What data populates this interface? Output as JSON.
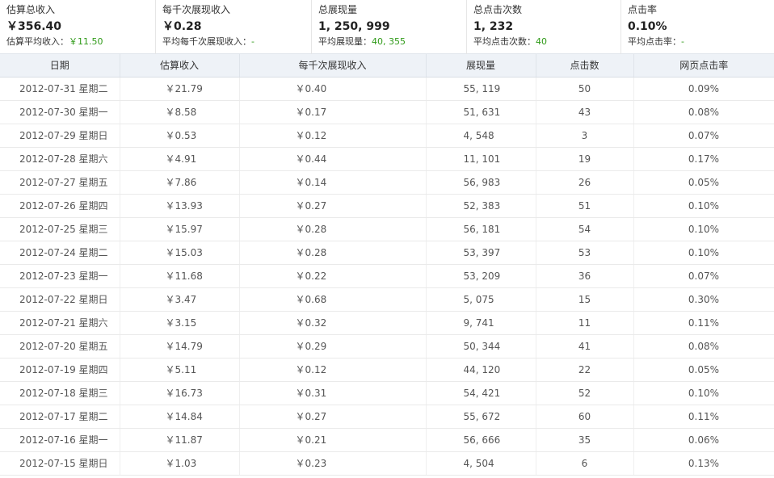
{
  "summary": [
    {
      "label": "估算总收入",
      "value": "￥356.40",
      "sub_label": "估算平均收入：",
      "sub_value": "￥11.50"
    },
    {
      "label": "每千次展现收入",
      "value": "￥0.28",
      "sub_label": "平均每千次展现收入：",
      "sub_value": "-"
    },
    {
      "label": "总展现量",
      "value": "1, 250, 999",
      "sub_label": "平均展现量：",
      "sub_value": "40, 355"
    },
    {
      "label": "总点击次数",
      "value": "1, 232",
      "sub_label": "平均点击次数：",
      "sub_value": "40"
    },
    {
      "label": "点击率",
      "value": "0.10%",
      "sub_label": "平均点击率：",
      "sub_value": "-"
    }
  ],
  "table": {
    "headers": [
      "日期",
      "估算收入",
      "每千次展现收入",
      "展现量",
      "点击数",
      "网页点击率"
    ],
    "rows": [
      [
        "2012-07-31 星期二",
        "￥21.79",
        "￥0.40",
        "55, 119",
        "50",
        "0.09%"
      ],
      [
        "2012-07-30 星期一",
        "￥8.58",
        "￥0.17",
        "51, 631",
        "43",
        "0.08%"
      ],
      [
        "2012-07-29 星期日",
        "￥0.53",
        "￥0.12",
        "4, 548",
        "3",
        "0.07%"
      ],
      [
        "2012-07-28 星期六",
        "￥4.91",
        "￥0.44",
        "11, 101",
        "19",
        "0.17%"
      ],
      [
        "2012-07-27 星期五",
        "￥7.86",
        "￥0.14",
        "56, 983",
        "26",
        "0.05%"
      ],
      [
        "2012-07-26 星期四",
        "￥13.93",
        "￥0.27",
        "52, 383",
        "51",
        "0.10%"
      ],
      [
        "2012-07-25 星期三",
        "￥15.97",
        "￥0.28",
        "56, 181",
        "54",
        "0.10%"
      ],
      [
        "2012-07-24 星期二",
        "￥15.03",
        "￥0.28",
        "53, 397",
        "53",
        "0.10%"
      ],
      [
        "2012-07-23 星期一",
        "￥11.68",
        "￥0.22",
        "53, 209",
        "36",
        "0.07%"
      ],
      [
        "2012-07-22 星期日",
        "￥3.47",
        "￥0.68",
        "5, 075",
        "15",
        "0.30%"
      ],
      [
        "2012-07-21 星期六",
        "￥3.15",
        "￥0.32",
        "9, 741",
        "11",
        "0.11%"
      ],
      [
        "2012-07-20 星期五",
        "￥14.79",
        "￥0.29",
        "50, 344",
        "41",
        "0.08%"
      ],
      [
        "2012-07-19 星期四",
        "￥5.11",
        "￥0.12",
        "44, 120",
        "22",
        "0.05%"
      ],
      [
        "2012-07-18 星期三",
        "￥16.73",
        "￥0.31",
        "54, 421",
        "52",
        "0.10%"
      ],
      [
        "2012-07-17 星期二",
        "￥14.84",
        "￥0.27",
        "55, 672",
        "60",
        "0.11%"
      ],
      [
        "2012-07-16 星期一",
        "￥11.87",
        "￥0.21",
        "56, 666",
        "35",
        "0.06%"
      ],
      [
        "2012-07-15 星期日",
        "￥1.03",
        "￥0.23",
        "4, 504",
        "6",
        "0.13%"
      ]
    ]
  }
}
